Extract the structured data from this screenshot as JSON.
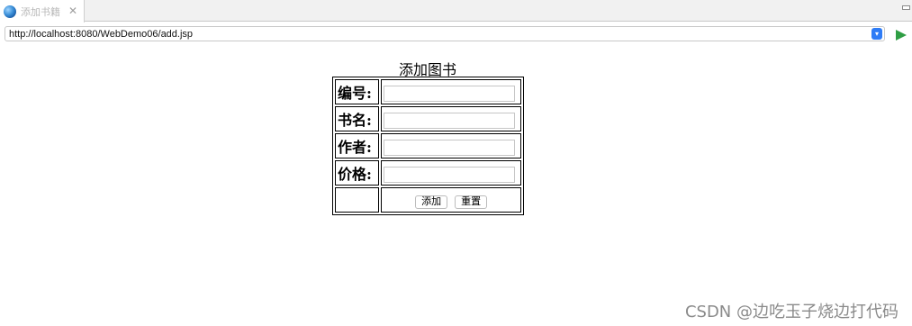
{
  "tab": {
    "title": "添加书籍",
    "close_glyph": "✕",
    "icon": "globe-icon"
  },
  "address_bar": {
    "url": "http://localhost:8080/WebDemo06/add.jsp",
    "go_icon": "play-arrow-icon"
  },
  "page": {
    "title": "添加图书",
    "fields": [
      {
        "label": "编号:",
        "value": ""
      },
      {
        "label": "书名:",
        "value": ""
      },
      {
        "label": "作者:",
        "value": ""
      },
      {
        "label": "价格:",
        "value": ""
      }
    ],
    "submit_label": "添加",
    "reset_label": "重置"
  },
  "watermark": "CSDN @边吃玉子烧边打代码"
}
